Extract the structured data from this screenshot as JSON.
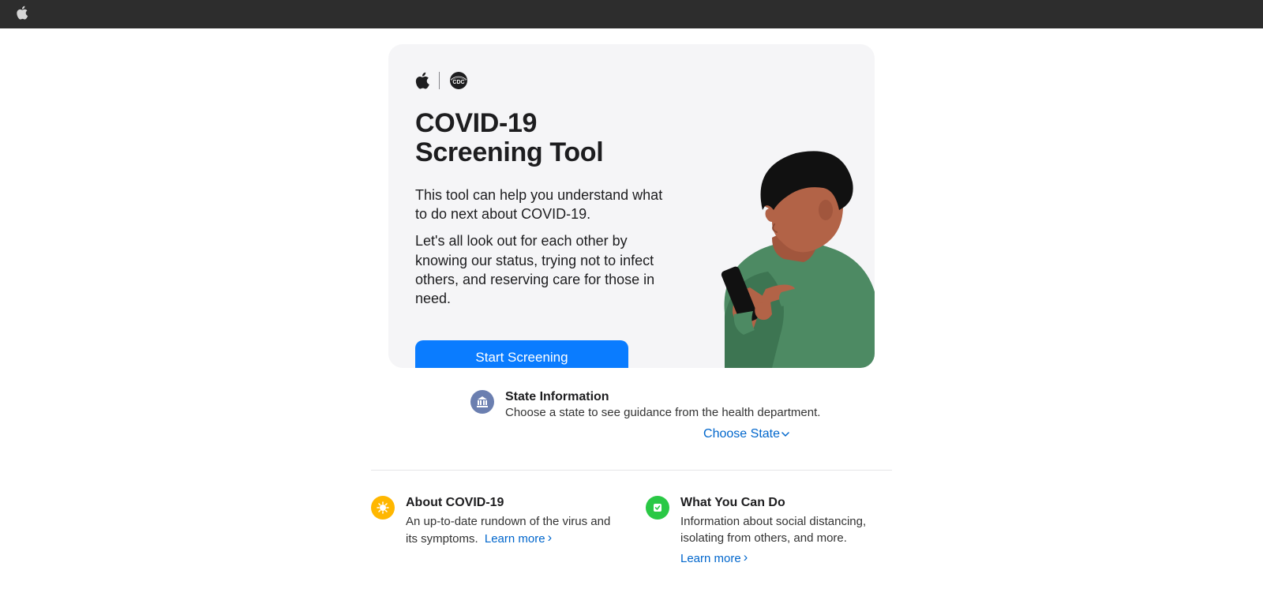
{
  "hero": {
    "title_l1": "COVID-19",
    "title_l2": "Screening Tool",
    "p1": "This tool can help you understand what to do next about COVID-19.",
    "p2": "Let's all look out for each other by knowing our status, trying not to infect others, and reserving care for those in need.",
    "cta": "Start Screening"
  },
  "state": {
    "title": "State Information",
    "desc": "Choose a state to see guidance from the health department.",
    "link": "Choose State"
  },
  "cards": {
    "about": {
      "title": "About COVID-19",
      "desc": "An up-to-date rundown of the virus and its symptoms.",
      "link": "Learn more"
    },
    "do": {
      "title": "What You Can Do",
      "desc": "Information about social distancing, isolating from others, and more.",
      "link": "Learn more"
    }
  }
}
